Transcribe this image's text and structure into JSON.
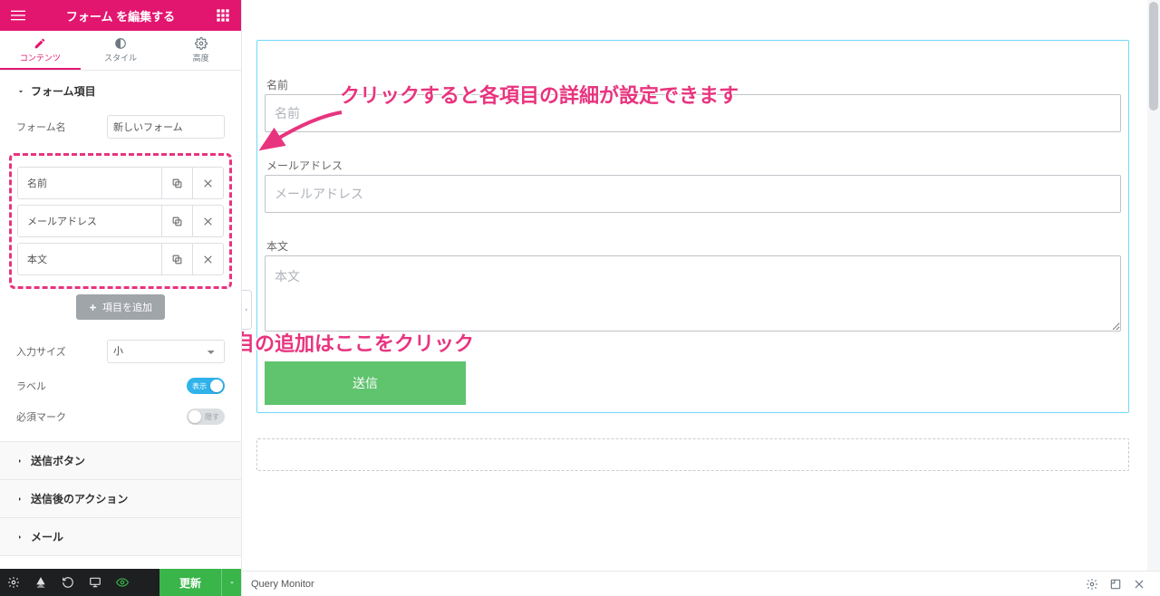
{
  "header": {
    "title": "フォーム を編集する"
  },
  "tabs": {
    "content": "コンテンツ",
    "style": "スタイル",
    "advanced": "高度"
  },
  "sections": {
    "form_fields": "フォーム項目",
    "submit_button": "送信ボタン",
    "actions_after_submit": "送信後のアクション",
    "mail": "メール"
  },
  "form_name": {
    "label": "フォーム名",
    "value": "新しいフォーム"
  },
  "repeater": [
    {
      "label": "名前"
    },
    {
      "label": "メールアドレス"
    },
    {
      "label": "本文"
    }
  ],
  "add_item": "項目を追加",
  "input_size": {
    "label": "入力サイズ",
    "value": "小"
  },
  "label_control": {
    "label": "ラベル",
    "on_text": "表示"
  },
  "required_mark": {
    "label": "必須マーク",
    "off_text": "隠す"
  },
  "footer": {
    "publish": "更新"
  },
  "preview": {
    "fields": {
      "name": {
        "label": "名前",
        "placeholder": "名前"
      },
      "email": {
        "label": "メールアドレス",
        "placeholder": "メールアドレス"
      },
      "body": {
        "label": "本文",
        "placeholder": "本文"
      }
    },
    "submit": "送信"
  },
  "annotations": {
    "detail": "クリックすると各項目の詳細が設定できます",
    "add": "項目の追加はここをクリック"
  },
  "statusbar": {
    "label": "Query Monitor"
  }
}
